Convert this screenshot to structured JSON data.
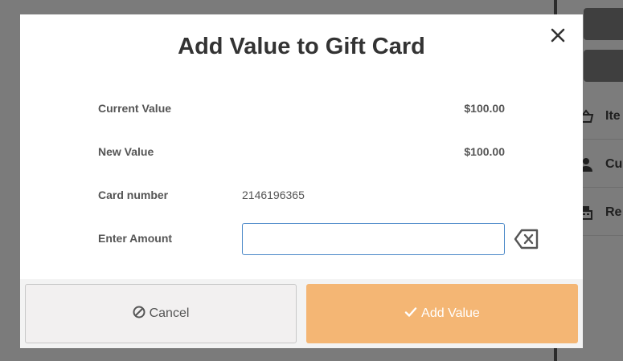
{
  "modal": {
    "title": "Add Value to Gift Card",
    "close_icon": "close-icon",
    "rows": {
      "current_value_label": "Current Value",
      "current_value": "$100.00",
      "new_value_label": "New Value",
      "new_value": "$100.00",
      "card_number_label": "Card number",
      "card_number": "2146196365",
      "enter_amount_label": "Enter Amount",
      "enter_amount_value": ""
    },
    "backspace_icon": "backspace-icon",
    "cancel_label": "Cancel",
    "cancel_icon": "ban-icon",
    "add_value_label": "Add Value",
    "add_value_icon": "check-icon"
  },
  "background": {
    "side_items": [
      {
        "label": "Ite",
        "icon": "basket-icon"
      },
      {
        "label": "Cu",
        "icon": "user-icon"
      },
      {
        "label": "Re",
        "icon": "register-icon"
      }
    ]
  },
  "colors": {
    "accent": "#f4b674",
    "input_border": "#4a88c8",
    "text": "#555555",
    "title": "#333333"
  }
}
